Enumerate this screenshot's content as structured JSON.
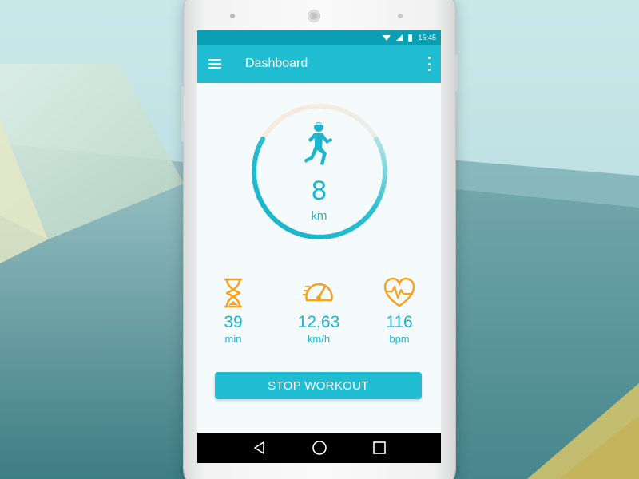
{
  "status_bar": {
    "time": "15:45"
  },
  "app_bar": {
    "title": "Dashboard"
  },
  "gauge": {
    "value": "8",
    "unit": "km",
    "progress": 0.75
  },
  "stats": [
    {
      "icon": "hourglass-icon",
      "value": "39",
      "unit": "min"
    },
    {
      "icon": "speedometer-icon",
      "value": "12,63",
      "unit": "km/h"
    },
    {
      "icon": "heart-rate-icon",
      "value": "116",
      "unit": "bpm"
    }
  ],
  "actions": {
    "stop_label": "STOP WORKOUT"
  },
  "colors": {
    "primary": "#21bdd3",
    "status_bar": "#0a9fb2",
    "accent": "#f7a21b",
    "text": "#1bb6cc"
  }
}
